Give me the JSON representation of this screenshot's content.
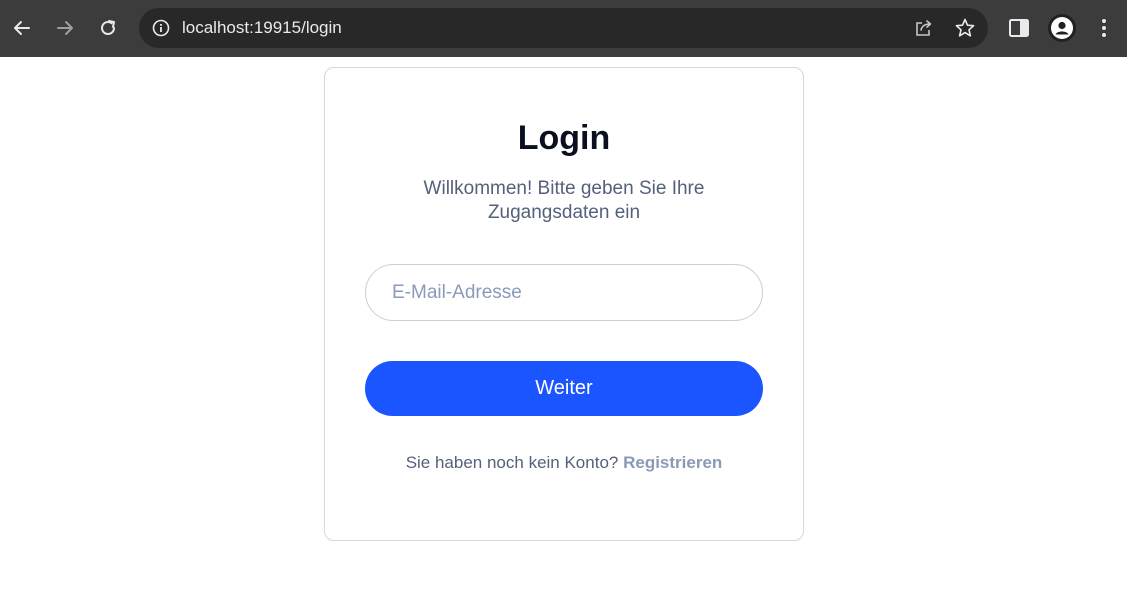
{
  "browser": {
    "url": "localhost:19915/login",
    "icons": {
      "back": "back-arrow-icon",
      "forward": "forward-arrow-icon",
      "reload": "reload-icon",
      "info": "info-icon",
      "share": "share-icon",
      "bookmark": "star-icon",
      "side_panel": "side-panel-icon",
      "profile": "profile-icon",
      "menu": "kebab-menu-icon"
    }
  },
  "login": {
    "title": "Login",
    "subtitle": "Willkommen! Bitte geben Sie Ihre Zugangsdaten ein",
    "email_placeholder": "E-Mail-Adresse",
    "email_value": "",
    "submit_label": "Weiter",
    "register_prompt": "Sie haben noch kein Konto?",
    "register_link": "Registrieren"
  },
  "colors": {
    "primary": "#1a55ff",
    "title": "#0b1020",
    "muted": "#55607a",
    "link": "#8a9ab8"
  }
}
